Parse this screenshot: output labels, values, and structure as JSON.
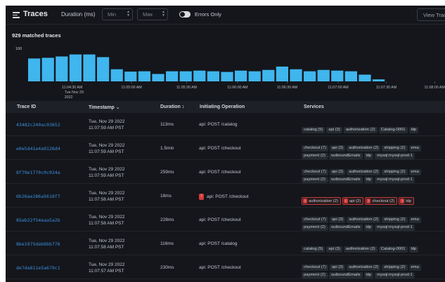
{
  "header": {
    "title": "Traces",
    "duration_label": "Duration (ms)",
    "min_placeholder": "Min",
    "max_placeholder": "Max",
    "errors_only_label": "Errors Only",
    "view_button_label": "View Trac"
  },
  "summary": {
    "matched": "929 matched traces"
  },
  "chart_data": {
    "type": "bar",
    "y_tick": "100",
    "values": [
      68,
      70,
      74,
      80,
      80,
      72,
      36,
      29,
      30,
      22,
      30,
      30,
      32,
      30,
      28,
      32,
      30,
      34,
      44,
      36,
      30,
      34,
      32,
      30,
      20,
      6
    ],
    "ylim": [
      0,
      100
    ],
    "x_ticks": [
      {
        "index": 3.2,
        "label": "11:04:30 AM",
        "sub1": "Tue Nov 29",
        "sub2": "2022"
      },
      {
        "index": 7.5,
        "label": "11:05:00 AM"
      },
      {
        "index": 11.5,
        "label": "11:05:30 AM"
      },
      {
        "index": 15.2,
        "label": "11:06:00 AM"
      },
      {
        "index": 18.8,
        "label": "11:06:30 AM"
      },
      {
        "index": 22.5,
        "label": "11:07:00 AM"
      },
      {
        "index": 26.0,
        "label": "11:07:30 AM"
      },
      {
        "index": 29.5,
        "label": "11:08:00 AM"
      },
      {
        "index": 33.0,
        "label": "11:08:30 AM"
      }
    ],
    "bar_color": "#3fb6ee"
  },
  "table": {
    "columns": [
      "Trace ID",
      "Timestamp ⌄",
      "Duration ↕",
      "Initiating Operation",
      "Services"
    ],
    "rows": [
      {
        "id": "43482c240ac93652",
        "ts1": "Tue, Nov 29 2022",
        "ts2": "11:07:59 AM PST",
        "duration": "113ms",
        "op": "api: POST /catalog",
        "op_error": false,
        "services": [
          [
            "catalog (5)",
            "api (3)",
            "authorization (2)",
            "Catalog-0001",
            "ldp"
          ]
        ],
        "more": false,
        "err_chips": []
      },
      {
        "id": "e0e5d41e4a9126d4",
        "ts1": "Tue, Nov 29 2022",
        "ts2": "11:07:59 AM PST",
        "duration": "1.5min",
        "op": "api: POST /checkout",
        "op_error": false,
        "services": [
          [
            "checkout (7)",
            "api (3)",
            "authorization (2)",
            "shipping (2)",
            "ema"
          ],
          [
            "payment (2)",
            "outboundEmails",
            "ldp",
            "mysql:mysql-prod-1"
          ]
        ],
        "more": true,
        "err_chips": []
      },
      {
        "id": "8f79e1770c0c024a",
        "ts1": "Tue, Nov 29 2022",
        "ts2": "11:07:59 AM PST",
        "duration": "259ms",
        "op": "api: POST /checkout",
        "op_error": false,
        "services": [
          [
            "checkout (7)",
            "api (3)",
            "authorization (2)",
            "shipping (2)",
            "ema"
          ],
          [
            "payment (2)",
            "outboundEmails",
            "ldp",
            "mysql:mysql-prod-1"
          ]
        ],
        "more": true,
        "err_chips": []
      },
      {
        "id": "6b26ae286a5618f7",
        "ts1": "Tue, Nov 29 2022",
        "ts2": "11:07:58 AM PST",
        "duration": "18ms",
        "op": "api: POST /checkout",
        "op_error": true,
        "services": [
          [
            "authorization (2)",
            "api (2)",
            "checkout (2)",
            "ldp"
          ]
        ],
        "more": false,
        "err_chips": [
          0,
          1,
          2,
          3
        ],
        "error_mark": "!"
      },
      {
        "id": "85eb22f54eaa5a2b",
        "ts1": "Tue, Nov 29 2022",
        "ts2": "11:07:58 AM PST",
        "duration": "228ms",
        "op": "api: POST /checkout",
        "op_error": false,
        "services": [
          [
            "checkout (7)",
            "api (3)",
            "authorization (2)",
            "shipping (2)",
            "ema"
          ],
          [
            "payment (2)",
            "outboundEmails",
            "ldp",
            "mysql:mysql-prod-1"
          ]
        ],
        "more": true,
        "err_chips": []
      },
      {
        "id": "8be1975dab6bb776",
        "ts1": "Tue, Nov 29 2022",
        "ts2": "11:07:58 AM PST",
        "duration": "116ms",
        "op": "api: POST /catalog",
        "op_error": false,
        "services": [
          [
            "catalog (5)",
            "api (3)",
            "authorization (2)",
            "Catalog-0001",
            "ldp"
          ]
        ],
        "more": false,
        "err_chips": []
      },
      {
        "id": "de7da811e5a679c1",
        "ts1": "Tue, Nov 29 2022",
        "ts2": "11:07:57 AM PST",
        "duration": "230ms",
        "op": "api: POST /checkout",
        "op_error": false,
        "services": [
          [
            "checkout (7)",
            "api (3)",
            "authorization (2)",
            "shipping (2)",
            "ema"
          ],
          [
            "payment (2)",
            "outboundEmails",
            "ldp",
            "mysql:mysql-prod-1"
          ]
        ],
        "more": true,
        "err_chips": []
      }
    ]
  },
  "icons": {
    "menu": "menu-icon",
    "spin": "spinner-arrows-icon",
    "toggle": "toggle-switch"
  }
}
